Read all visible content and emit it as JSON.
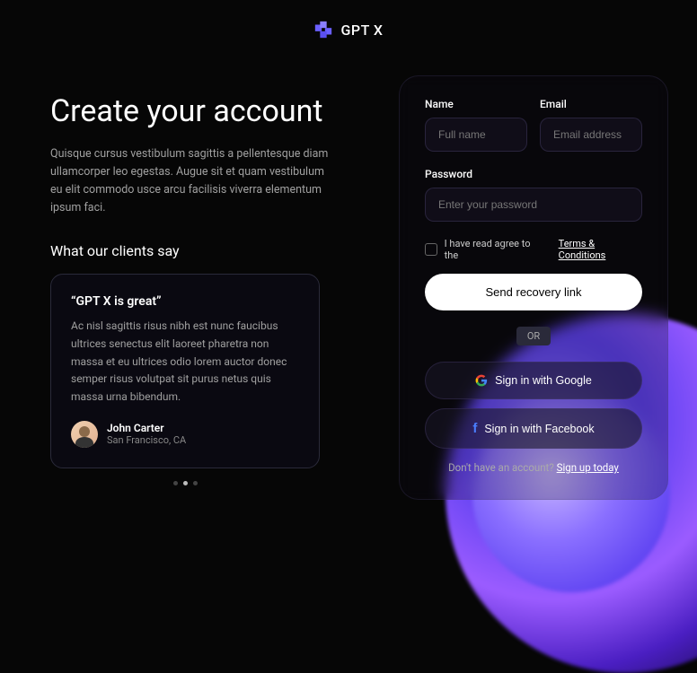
{
  "brand": {
    "name": "GPT X"
  },
  "left": {
    "heading": "Create your account",
    "subtitle": "Quisque cursus vestibulum sagittis a pellentesque diam ullamcorper leo egestas. Augue sit et quam vestibulum eu elit commodo usce arcu facilisis viverra elementum ipsum faci.",
    "socialProof": {
      "heading": "What our clients say",
      "testimonial": {
        "title": "“GPT X is great”",
        "body": "Ac nisl sagittis risus nibh est nunc faucibus ultrices senectus elit laoreet pharetra non massa et eu ultrices odio lorem auctor donec semper risus volutpat sit purus netus quis massa urna bibendum.",
        "author": "John Carter",
        "location": "San Francisco, CA"
      }
    }
  },
  "form": {
    "nameLabel": "Name",
    "namePlaceholder": "Full name",
    "emailLabel": "Email",
    "emailPlaceholder": "Email address",
    "passwordLabel": "Password",
    "passwordPlaceholder": "Enter your password",
    "agreeText": "I have read agree to the",
    "termsLink": "Terms & Conditions",
    "submitLabel": "Send recovery link",
    "divider": "OR",
    "googleLabel": "Sign in with Google",
    "facebookLabel": "Sign in with Facebook",
    "footerText": "Don't have an account? ",
    "footerLink": "Sign up today"
  }
}
